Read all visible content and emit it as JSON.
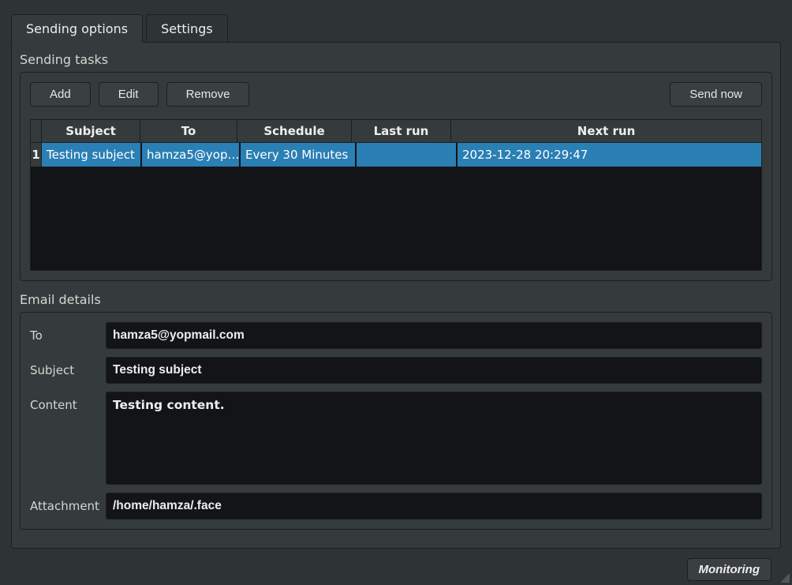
{
  "tabs": {
    "active": "Sending options",
    "settings": "Settings"
  },
  "tasks": {
    "title": "Sending tasks",
    "buttons": {
      "add": "Add",
      "edit": "Edit",
      "remove": "Remove",
      "send_now": "Send now"
    },
    "columns": {
      "subject": "Subject",
      "to": "To",
      "schedule": "Schedule",
      "last_run": "Last run",
      "next_run": "Next run"
    },
    "rows": [
      {
        "index": "1",
        "subject": "Testing subject",
        "to": "hamza5@yop…",
        "schedule": "Every 30 Minutes",
        "last_run": "",
        "next_run": "2023-12-28 20:29:47"
      }
    ]
  },
  "details": {
    "title": "Email details",
    "labels": {
      "to": "To",
      "subject": "Subject",
      "content": "Content",
      "attachment": "Attachment"
    },
    "to": "hamza5@yopmail.com",
    "subject": "Testing subject",
    "content": "Testing content.",
    "attachment": "/home/hamza/.face"
  },
  "status": {
    "button": "Monitoring"
  }
}
